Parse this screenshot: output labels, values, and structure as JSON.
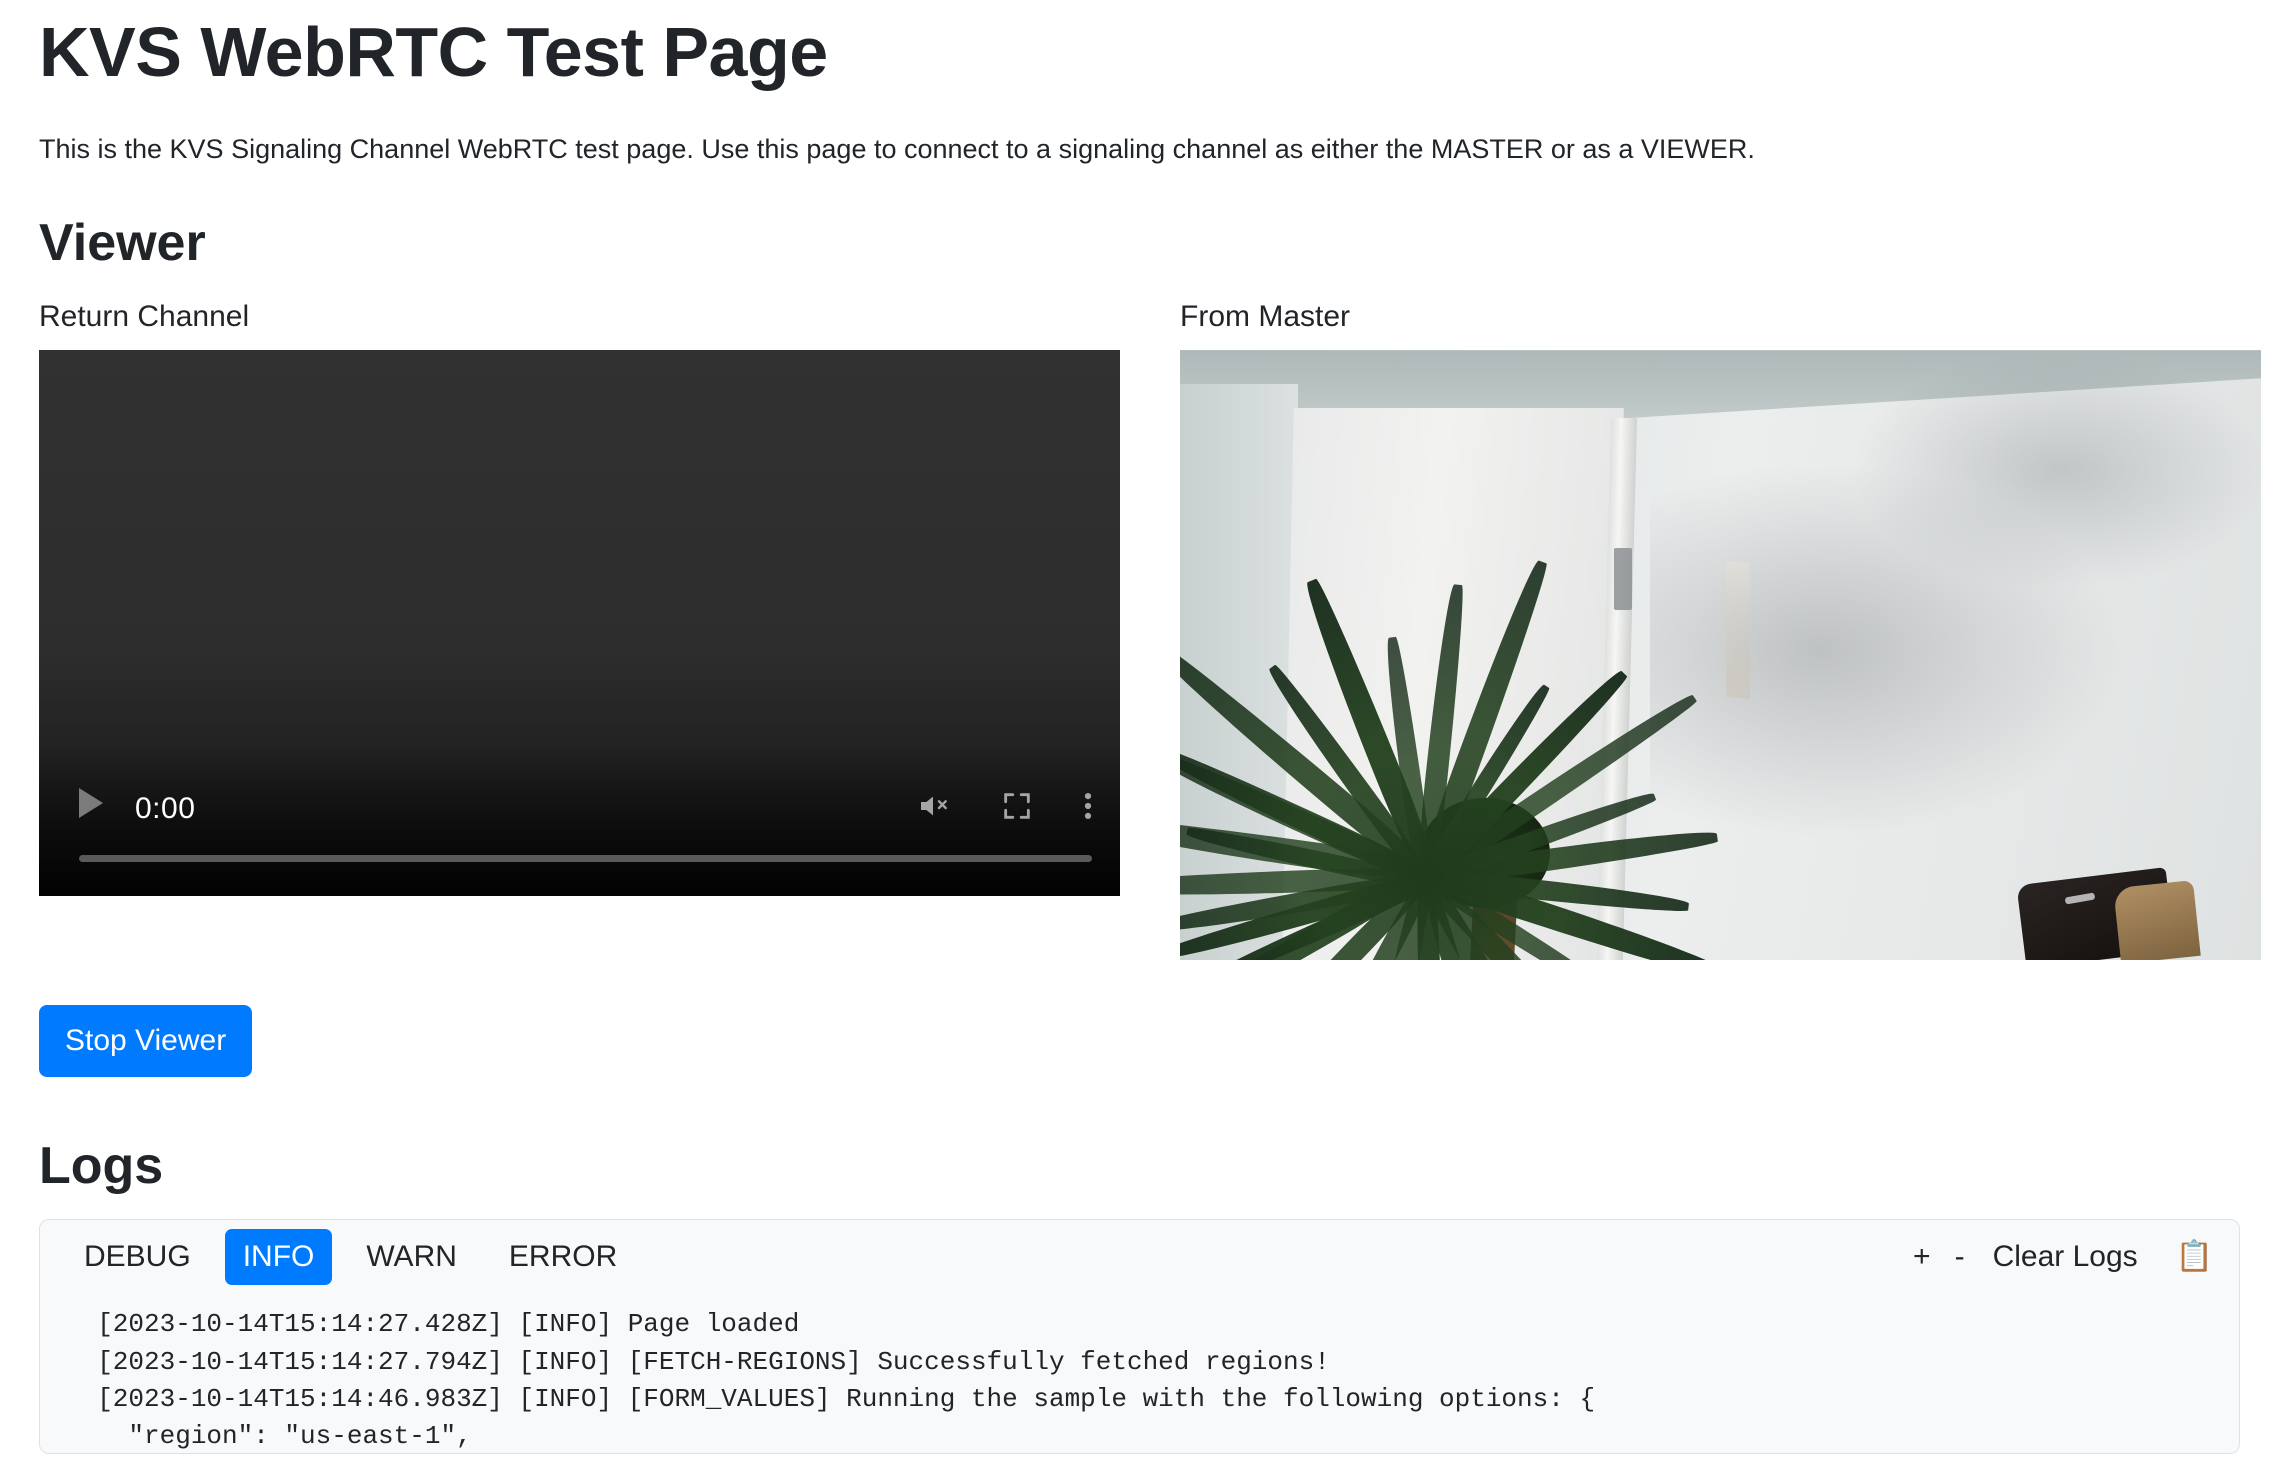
{
  "header": {
    "title": "KVS WebRTC Test Page",
    "subtitle": "This is the KVS Signaling Channel WebRTC test page. Use this page to connect to a signaling channel as either the MASTER or as a VIEWER."
  },
  "viewer": {
    "section_title": "Viewer",
    "local": {
      "label": "Return Channel",
      "current_time": "0:00",
      "play_icon": "play-icon",
      "mute_icon": "muted-volume-icon",
      "fullscreen_icon": "fullscreen-icon",
      "overflow_icon": "kebab-menu-icon"
    },
    "remote": {
      "label": "From Master",
      "scene_description": "Indoor room with a spiky dracaena plant in front of a white door, light wall with shadow and a dark object at lower right"
    },
    "stop_button": "Stop Viewer"
  },
  "logs": {
    "title": "Logs",
    "levels": [
      {
        "label": "DEBUG",
        "active": false
      },
      {
        "label": "INFO",
        "active": true
      },
      {
        "label": "WARN",
        "active": false
      },
      {
        "label": "ERROR",
        "active": false
      }
    ],
    "increase_font": "+",
    "decrease_font": "-",
    "clear_label": "Clear Logs",
    "copy_icon": "clipboard-icon",
    "copy_glyph": "📋",
    "lines": [
      "  [2023-10-14T15:14:27.428Z] [INFO] Page loaded",
      "  [2023-10-14T15:14:27.794Z] [INFO] [FETCH-REGIONS] Successfully fetched regions!",
      "  [2023-10-14T15:14:46.983Z] [INFO] [FORM_VALUES] Running the sample with the following options: {",
      "    \"region\": \"us-east-1\","
    ]
  },
  "colors": {
    "accent": "#007bff",
    "panel_bg": "#f8f9fa",
    "panel_border": "#dee2e6",
    "text": "#212529"
  }
}
